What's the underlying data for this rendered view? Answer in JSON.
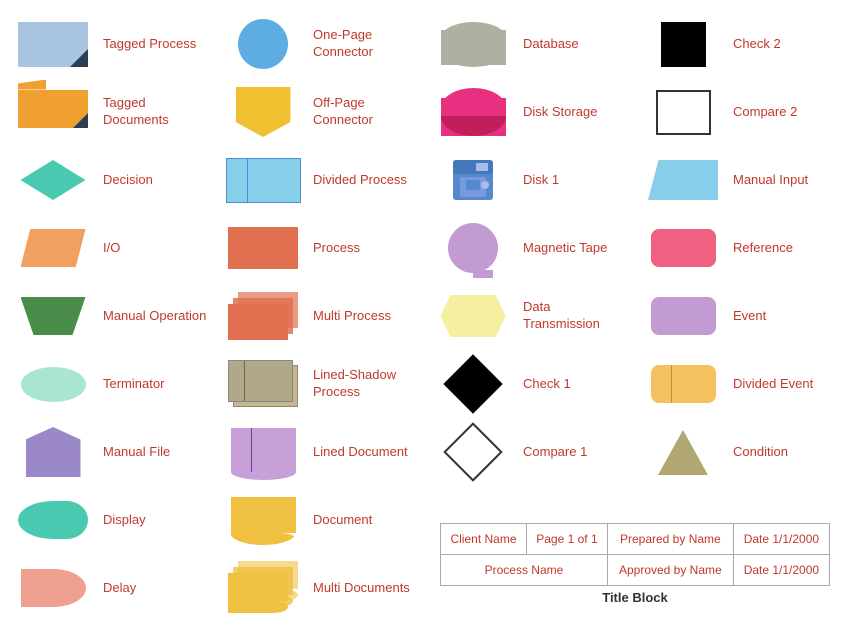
{
  "shapes": {
    "row1": [
      {
        "id": "tagged-process",
        "label": "Tagged Process"
      },
      {
        "id": "one-page-connector",
        "label": "One-Page Connector"
      },
      {
        "id": "database",
        "label": "Database"
      },
      {
        "id": "check2",
        "label": "Check 2"
      }
    ],
    "row2": [
      {
        "id": "tagged-documents",
        "label": "Tagged Documents"
      },
      {
        "id": "off-page-connector",
        "label": "Off-Page Connector"
      },
      {
        "id": "disk-storage",
        "label": "Disk Storage"
      },
      {
        "id": "compare2",
        "label": "Compare 2"
      }
    ],
    "row3": [
      {
        "id": "decision",
        "label": "Decision"
      },
      {
        "id": "divided-process",
        "label": "Divided Process"
      },
      {
        "id": "disk1",
        "label": "Disk 1"
      },
      {
        "id": "manual-input",
        "label": "Manual Input"
      }
    ],
    "row4": [
      {
        "id": "io",
        "label": "I/O"
      },
      {
        "id": "process",
        "label": "Process"
      },
      {
        "id": "magnetic-tape",
        "label": "Magnetic Tape"
      },
      {
        "id": "reference",
        "label": "Reference"
      }
    ],
    "row5": [
      {
        "id": "manual-operation",
        "label": "Manual Operation"
      },
      {
        "id": "multi-process",
        "label": "Multi Process"
      },
      {
        "id": "data-transmission",
        "label": "Data Transmission"
      },
      {
        "id": "event",
        "label": "Event"
      }
    ],
    "row6": [
      {
        "id": "terminator",
        "label": "Terminator"
      },
      {
        "id": "lined-shadow-process",
        "label": "Lined-Shadow Process"
      },
      {
        "id": "check1",
        "label": "Check 1"
      },
      {
        "id": "divided-event",
        "label": "Divided Event"
      }
    ],
    "row7": [
      {
        "id": "manual-file",
        "label": "Manual File"
      },
      {
        "id": "lined-document",
        "label": "Lined Document"
      },
      {
        "id": "compare1",
        "label": "Compare 1"
      },
      {
        "id": "condition",
        "label": "Condition"
      }
    ],
    "row8": [
      {
        "id": "display",
        "label": "Display"
      },
      {
        "id": "document",
        "label": "Document"
      }
    ],
    "row9": [
      {
        "id": "delay",
        "label": "Delay"
      },
      {
        "id": "multi-documents",
        "label": "Multi Documents"
      }
    ]
  },
  "title_block": {
    "rows": [
      [
        {
          "label": "Client Name"
        },
        {
          "label": "Page 1 of 1"
        },
        {
          "label": "Prepared by Name"
        },
        {
          "label": "Date 1/1/2000"
        }
      ],
      [
        {
          "label": "Process Name"
        },
        {
          "label": ""
        },
        {
          "label": "Approved by Name"
        },
        {
          "label": "Date 1/1/2000"
        }
      ]
    ],
    "footer": "Title Block"
  }
}
